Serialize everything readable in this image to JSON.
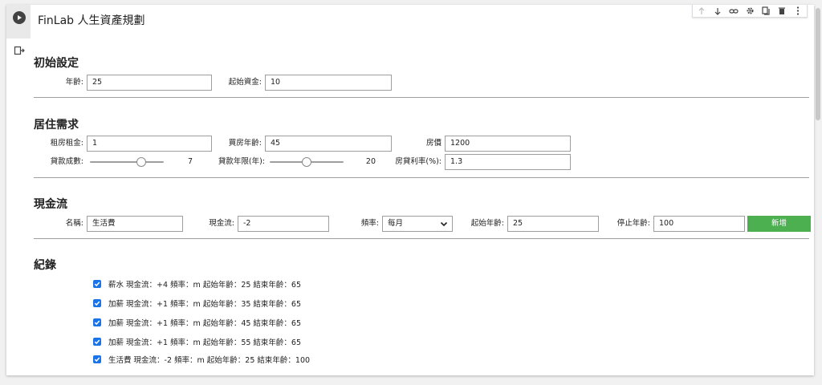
{
  "title": "FinLab 人生資產規劃",
  "icons": {
    "run": "play-circle-icon",
    "output": "output-exit-icon",
    "toolbar": [
      "arrow-up-icon",
      "arrow-down-icon",
      "link-icon",
      "gear-icon",
      "mirror-cell-icon",
      "trash-icon",
      "more-vert-icon"
    ]
  },
  "sections": {
    "initial": {
      "title": "初始設定",
      "age_label": "年齡:",
      "age_value": "25",
      "capital_label": "起始資金:",
      "capital_value": "10"
    },
    "housing": {
      "title": "居住需求",
      "rent_label": "租房租金:",
      "rent_value": "1",
      "buy_age_label": "買房年齡:",
      "buy_age_value": "45",
      "price_label": "房價",
      "price_value": "1200",
      "loan_ratio_label": "貸款成數:",
      "loan_ratio_value": "7",
      "loan_ratio_level": 0.7,
      "loan_years_label": "貸款年限(年):",
      "loan_years_value": "20",
      "loan_years_level": 0.5,
      "rate_label": "房貸利率(%):",
      "rate_value": "1.3"
    },
    "cashflow": {
      "title": "現金流",
      "name_label": "名稱:",
      "name_value": "生活費",
      "flow_label": "現金流:",
      "flow_value": "-2",
      "freq_label": "頻率:",
      "freq_value": "每月",
      "start_label": "起始年齡:",
      "start_value": "25",
      "stop_label": "停止年齡:",
      "stop_value": "100",
      "add_label": "新增"
    },
    "records": {
      "title": "紀錄",
      "items": [
        {
          "text": "薪水 現金流：+4 頻率：m 起始年齡：25 結束年齡：65",
          "checked": true
        },
        {
          "text": "加薪 現金流：+1 頻率：m 起始年齡：35 結束年齡：65",
          "checked": true
        },
        {
          "text": "加薪 現金流：+1 頻率：m 起始年齡：45 結束年齡：65",
          "checked": true
        },
        {
          "text": "加薪 現金流：+1 頻率：m 起始年齡：55 結束年齡：65",
          "checked": true
        },
        {
          "text": "生活費 現金流：-2 頻率：m 起始年齡：25 結束年齡：100",
          "checked": true
        }
      ]
    }
  },
  "colors": {
    "accent": "#1a73e8",
    "add_button": "#4caf50"
  }
}
